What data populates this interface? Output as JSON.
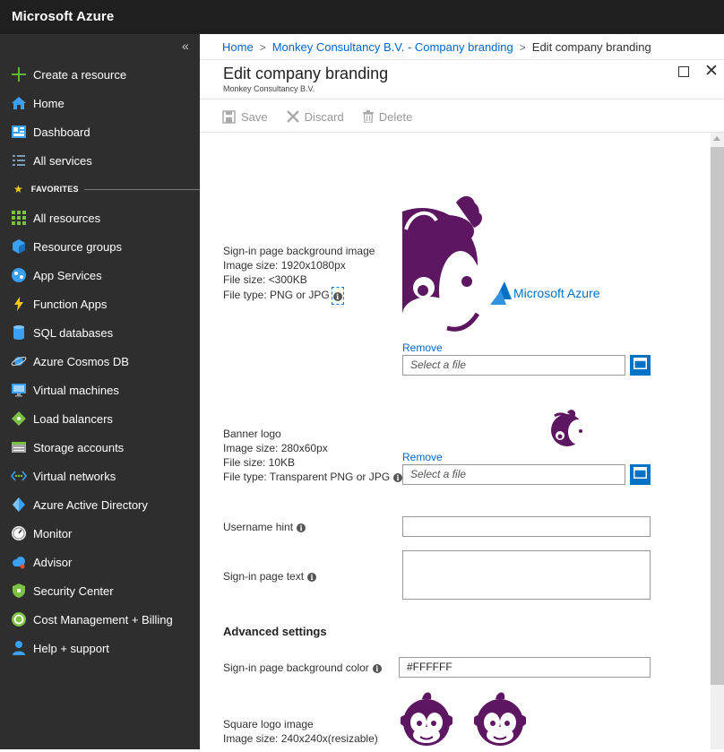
{
  "app": {
    "title": "Microsoft Azure"
  },
  "sidebar": {
    "collapse_glyph": "«",
    "items": [
      {
        "label": "Create a resource",
        "icon": "plus-icon"
      },
      {
        "label": "Home",
        "icon": "home-icon"
      },
      {
        "label": "Dashboard",
        "icon": "dashboard-icon"
      },
      {
        "label": "All services",
        "icon": "list-icon"
      }
    ],
    "favorites_label": "FAVORITES",
    "favorites": [
      {
        "label": "All resources",
        "icon": "grid-icon"
      },
      {
        "label": "Resource groups",
        "icon": "cube-icon"
      },
      {
        "label": "App Services",
        "icon": "globe-icon"
      },
      {
        "label": "Function Apps",
        "icon": "lightning-icon"
      },
      {
        "label": "SQL databases",
        "icon": "database-icon"
      },
      {
        "label": "Azure Cosmos DB",
        "icon": "planet-icon"
      },
      {
        "label": "Virtual machines",
        "icon": "monitor-icon"
      },
      {
        "label": "Load balancers",
        "icon": "diamond-icon"
      },
      {
        "label": "Storage accounts",
        "icon": "storage-icon"
      },
      {
        "label": "Virtual networks",
        "icon": "network-icon"
      },
      {
        "label": "Azure Active Directory",
        "icon": "directory-icon"
      },
      {
        "label": "Monitor",
        "icon": "gauge-icon"
      },
      {
        "label": "Advisor",
        "icon": "cloud-icon"
      },
      {
        "label": "Security Center",
        "icon": "shield-icon"
      },
      {
        "label": "Cost Management + Billing",
        "icon": "coin-icon"
      },
      {
        "label": "Help + support",
        "icon": "person-icon"
      }
    ]
  },
  "breadcrumb": {
    "home": "Home",
    "company": "Monkey Consultancy B.V. - Company branding",
    "current": "Edit company branding",
    "sep": ">"
  },
  "blade": {
    "title": "Edit company branding",
    "subtitle": "Monkey Consultancy B.V."
  },
  "toolbar": {
    "save": "Save",
    "discard": "Discard",
    "delete": "Delete"
  },
  "form": {
    "bg_image": {
      "label": "Sign-in page background image",
      "size": "Image size: 1920x1080px",
      "file_size": "File size: <300KB",
      "file_type": "File type: PNG or JPG",
      "remove": "Remove",
      "placeholder": "Select a file",
      "preview_text": "Microsoft Azure"
    },
    "banner": {
      "label": "Banner logo",
      "size": "Image size: 280x60px",
      "file_size": "File size: 10KB",
      "file_type": "File type: Transparent PNG or JPG",
      "remove": "Remove",
      "placeholder": "Select a file"
    },
    "username_hint": {
      "label": "Username hint",
      "value": ""
    },
    "signin_text": {
      "label": "Sign-in page text",
      "value": ""
    },
    "advanced": "Advanced settings",
    "bg_color": {
      "label": "Sign-in page background color",
      "value": "#FFFFFF"
    },
    "square_logo": {
      "label": "Square logo image",
      "size": "Image size: 240x240x(resizable)"
    },
    "info_glyph": "i"
  },
  "colors": {
    "topbar": "#1f1f1f",
    "sidebar": "#2e2e2e",
    "accent": "#0072c6",
    "link": "#0066cc",
    "monkey": "#5d1760"
  }
}
